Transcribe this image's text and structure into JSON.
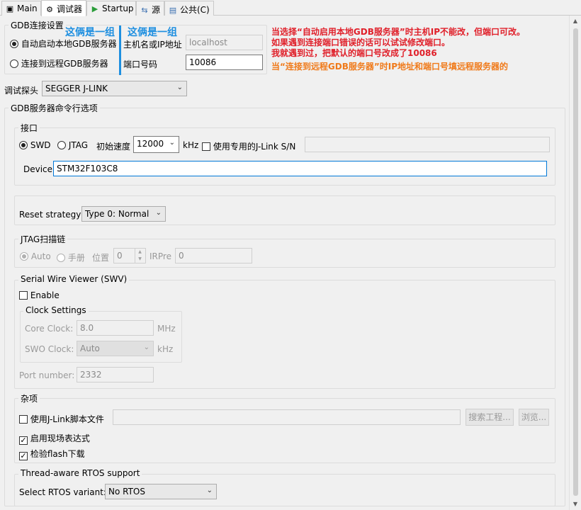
{
  "tabs": [
    {
      "icon": "main-icon",
      "glyph": "▣",
      "label": "Main"
    },
    {
      "icon": "debugger-icon",
      "glyph": "⚙",
      "label": "调试器"
    },
    {
      "icon": "startup-icon",
      "glyph": "▶",
      "label": "Startup"
    },
    {
      "icon": "source-icon",
      "glyph": "⇆",
      "label": "源"
    },
    {
      "icon": "common-icon",
      "glyph": "▤",
      "label": "公共(C)"
    }
  ],
  "gdb": {
    "legend": "GDB连接设置",
    "local_label": "自动启动本地GDB服务器",
    "remote_label": "连接到远程GDB服务器",
    "host_label": "主机名或IP地址",
    "host_value": "localhost",
    "port_label": "端口号码",
    "port_value": "10086"
  },
  "annotations": {
    "group1": "这俩是一组",
    "group2": "这俩是一组",
    "red1": "当选择“自动启用本地GDB服务器”时主机IP不能改，但端口可改。",
    "red2": "如果遇到连接端口错误的话可以试试修改端口。",
    "red3": "我就遇到过，把默认的端口号改成了10086",
    "orange": "当“连接到远程GDB服务器”时IP地址和端口号填远程服务器的"
  },
  "probe": {
    "label": "调试探头",
    "value": "SEGGER J-LINK"
  },
  "cmd_options": {
    "legend": "GDB服务器命令行选项"
  },
  "interface": {
    "legend": "接口",
    "swd": "SWD",
    "jtag": "JTAG",
    "speed_label": "初始速度",
    "speed_value": "12000",
    "speed_unit": "kHz",
    "sn_label": "使用专用的J-Link S/N",
    "sn_value": "",
    "device_label": "Device",
    "device_value": "STM32F103C8"
  },
  "reset": {
    "label": "Reset strategy",
    "value": "Type 0: Normal"
  },
  "jtag_chain": {
    "legend": "JTAG扫描链",
    "auto": "Auto",
    "manual": "手册",
    "pos_label": "位置",
    "pos_value": "0",
    "irpre_label": "IRPre",
    "irpre_value": "0"
  },
  "swv": {
    "legend": "Serial Wire Viewer (SWV)",
    "enable": "Enable",
    "clock_legend": "Clock Settings",
    "core_label": "Core Clock:",
    "core_value": "8.0",
    "core_unit": "MHz",
    "swo_label": "SWO Clock:",
    "swo_value": "Auto",
    "swo_unit": "kHz",
    "port_label": "Port number:",
    "port_value": "2332"
  },
  "misc": {
    "legend": "杂项",
    "script_label": "使用J-Link脚本文件",
    "script_value": "",
    "search_btn": "搜索工程...",
    "browse_btn": "浏览...",
    "live_expr": "启用现场表达式",
    "verify_flash": "检验flash下载"
  },
  "rtos": {
    "legend": "Thread-aware RTOS support",
    "label": "Select RTOS variant:",
    "value": "No RTOS"
  }
}
